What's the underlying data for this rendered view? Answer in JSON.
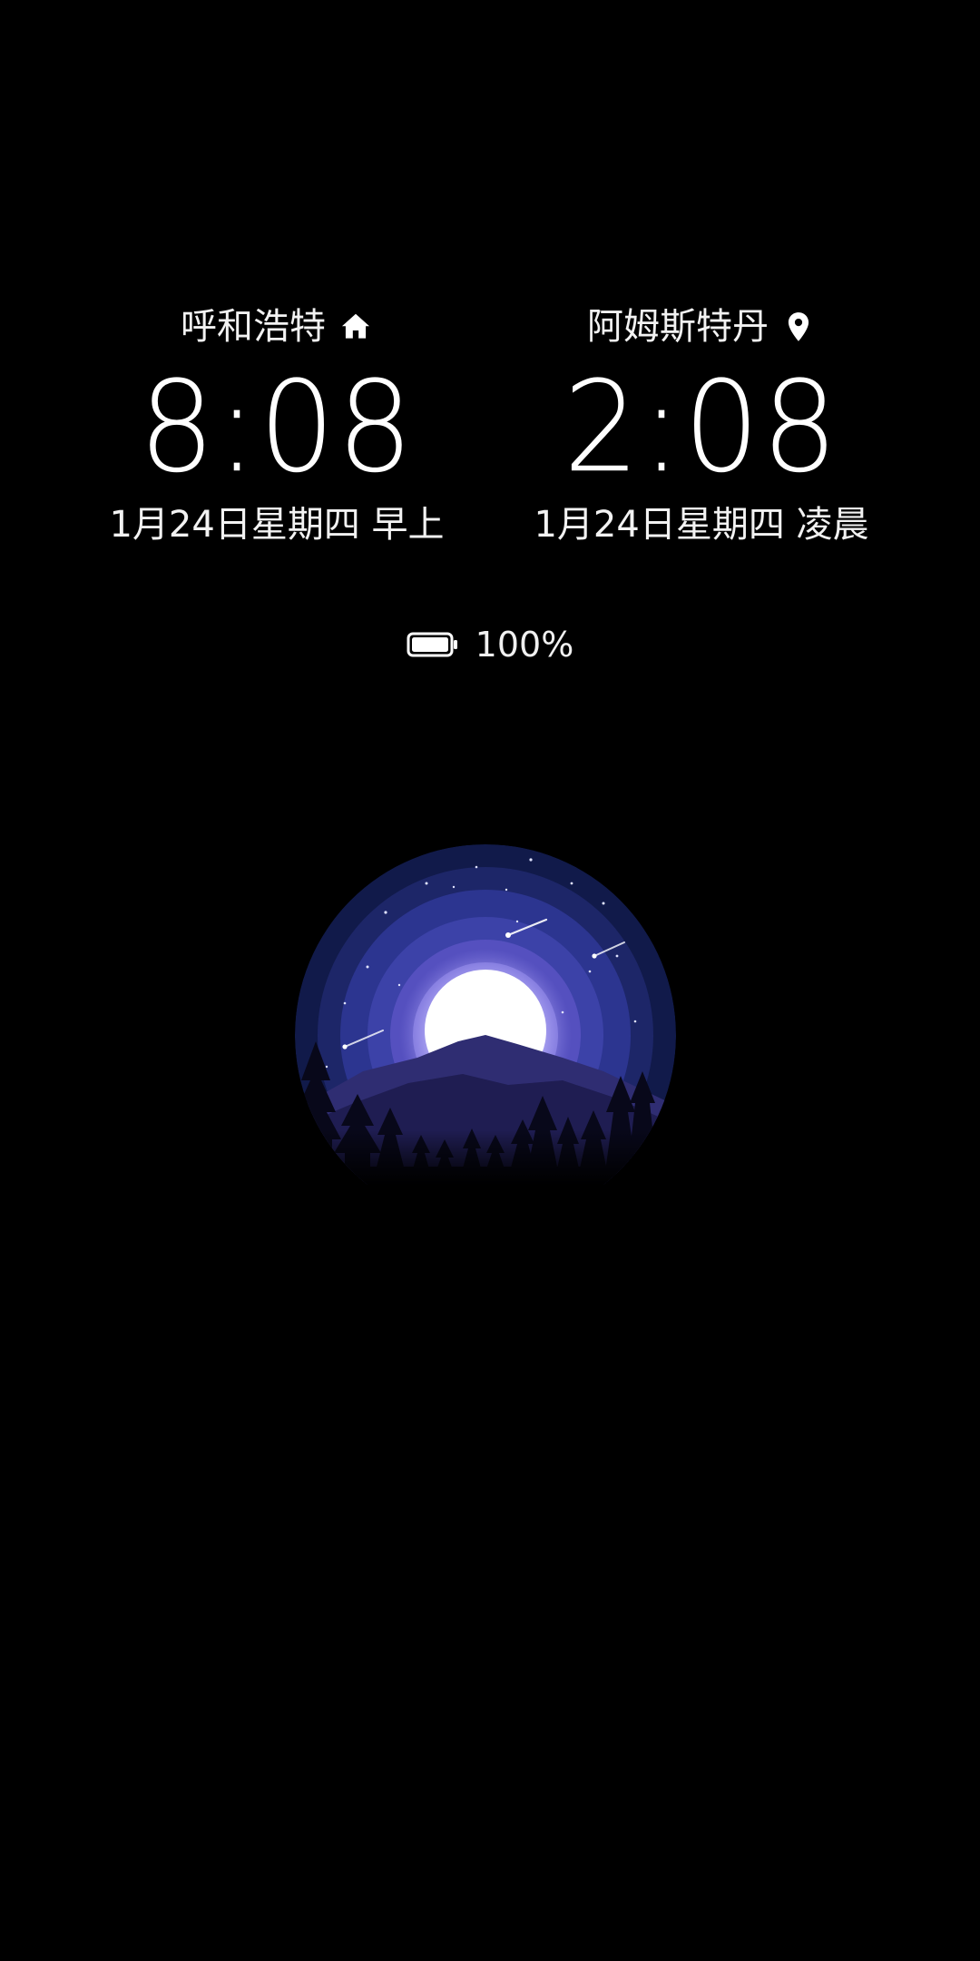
{
  "clocks": [
    {
      "city": "呼和浩特",
      "icon": "home-icon",
      "time": "8:08",
      "date": "1月24日星期四 早上"
    },
    {
      "city": "阿姆斯特丹",
      "icon": "location-pin-icon",
      "time": "2:08",
      "date": "1月24日星期四 凌晨"
    }
  ],
  "battery": {
    "icon": "battery-icon",
    "level": 1.0,
    "label": "100%"
  },
  "wallpaper": {
    "icon": "night-landscape-illustration",
    "colors": {
      "sky_outer": "#111a4a",
      "sky_mid": "#2c3590",
      "sky_inner": "#6a62d0",
      "moon": "#ffffff",
      "mountain": "#2a2a6a"
    }
  }
}
